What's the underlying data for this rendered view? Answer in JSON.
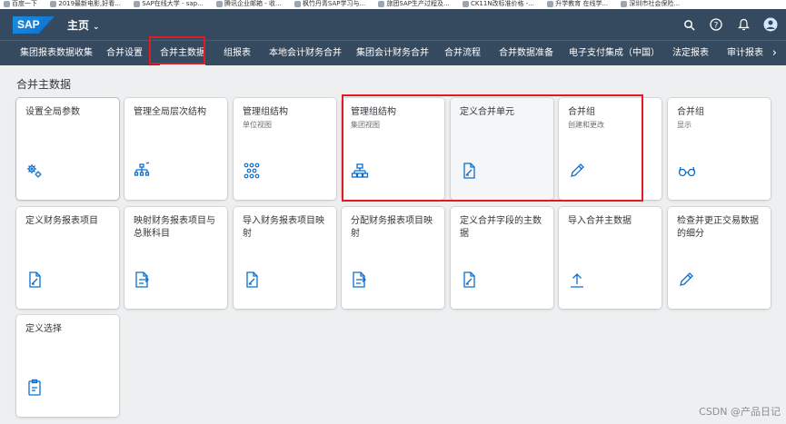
{
  "bookmarks": [
    "百度一下",
    "2019最新电影,好看...",
    "SAP在线大学 - sap...",
    "腾讯企业邮箱 - 收...",
    "枫竹丹青SAP学习与...",
    "旅团SAP生产过程及...",
    "CK11N改标准价格 -...",
    "升学教育 在线学...",
    "深圳市社会保险..."
  ],
  "shell": {
    "logo": "SAP",
    "title": "主页",
    "icons": [
      "search-icon",
      "help-icon",
      "bell-icon",
      "avatar-icon"
    ]
  },
  "tabs": [
    {
      "label": "集团报表数据收集"
    },
    {
      "label": "合并设置"
    },
    {
      "label": "合并主数据"
    },
    {
      "label": "组报表"
    },
    {
      "label": "本地会计财务合并"
    },
    {
      "label": "集团会计财务合并"
    },
    {
      "label": "合并流程"
    },
    {
      "label": "合并数据准备"
    },
    {
      "label": "电子支付集成（中国）"
    },
    {
      "label": "法定报表"
    },
    {
      "label": "审计报表"
    }
  ],
  "active_tab": "合并主数据",
  "section_title": "合并主数据",
  "tiles": [
    {
      "title": "设置全局参数",
      "subtitle": "",
      "icon": "gear-icon"
    },
    {
      "title": "管理全局层次结构",
      "subtitle": "",
      "icon": "hierarchy-icon"
    },
    {
      "title": "管理组结构",
      "subtitle": "单位视图",
      "icon": "network-icon"
    },
    {
      "title": "管理组结构",
      "subtitle": "集团视图",
      "icon": "org-chart-icon"
    },
    {
      "title": "定义合并单元",
      "subtitle": "",
      "icon": "document-edit-icon"
    },
    {
      "title": "合并组",
      "subtitle": "创建和更改",
      "icon": "pencil-icon"
    },
    {
      "title": "合并组",
      "subtitle": "显示",
      "icon": "glasses-icon"
    },
    {
      "title": "定义财务报表项目",
      "subtitle": "",
      "icon": "document-edit-icon"
    },
    {
      "title": "映射财务报表项目与总账科目",
      "subtitle": "",
      "icon": "document-map-icon"
    },
    {
      "title": "导入财务报表项目映射",
      "subtitle": "",
      "icon": "document-edit-icon"
    },
    {
      "title": "分配财务报表项目映射",
      "subtitle": "",
      "icon": "document-map-icon"
    },
    {
      "title": "定义合并字段的主数据",
      "subtitle": "",
      "icon": "document-edit-icon"
    },
    {
      "title": "导入合并主数据",
      "subtitle": "",
      "icon": "upload-icon"
    },
    {
      "title": "检查并更正交易数据的细分",
      "subtitle": "",
      "icon": "pencil-icon"
    },
    {
      "title": "定义选择",
      "subtitle": "",
      "icon": "clipboard-icon"
    }
  ],
  "watermark": "CSDN @产品日记",
  "colors": {
    "shell": "#354a5f",
    "background": "#edeff0",
    "highlight": "#e01b24",
    "icon": "#0a6ed1"
  }
}
